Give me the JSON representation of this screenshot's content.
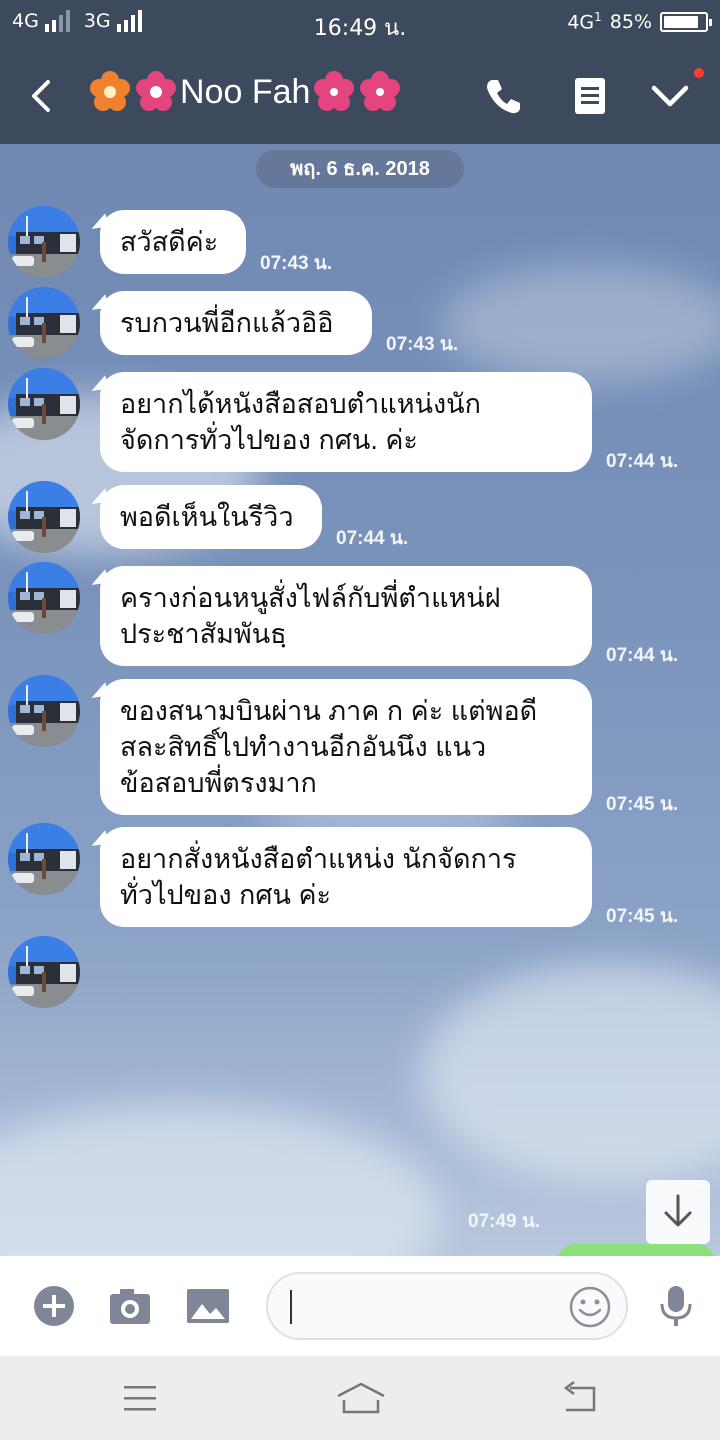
{
  "status": {
    "net1": "4G",
    "net2": "3G",
    "time": "16:49 น.",
    "net3": "4G",
    "net3_sub": "1",
    "battery_pct": "85%",
    "battery_level": 0.85
  },
  "header": {
    "contact_name": "Noo Fah",
    "colors": {
      "bar": "#3d4a5e",
      "flower_orange": "#f0822f",
      "flower_pink": "#e4457e"
    }
  },
  "chat": {
    "date": "พฤ. 6 ธ.ค. 2018",
    "messages": [
      {
        "lines": [
          "สวัสดีค่ะ"
        ],
        "time": "07:43 น."
      },
      {
        "lines": [
          "รบกวนพี่อีกแล้วอิอิ"
        ],
        "time": "07:43 น."
      },
      {
        "lines": [
          "อยากได้หนังสือสอบตำแหน่งนัก",
          "จัดการทั่วไปของ กศน. ค่ะ"
        ],
        "time": "07:44 น."
      },
      {
        "lines": [
          "พอดีเห็นในรีวิว"
        ],
        "time": "07:44 น."
      },
      {
        "lines": [
          "ครางก่อนหนูสั่งไฟล์กับพี่ตำแหน่ฝ",
          "ประชาสัมพันธฺ"
        ],
        "time": "07:44 น."
      },
      {
        "lines": [
          "ของสนามบินผ่าน ภาค ก ค่ะ แต่พอดี",
          "สละสิทธิ์ไปทำงานอีกอันนึง แนว",
          "ข้อสอบพี่ตรงมาก"
        ],
        "time": "07:45 น."
      },
      {
        "lines": [
          "อยากสั่งหนังสือตำแหน่ง นักจัดการ",
          "ทั่วไปของ กศน ค่ะ"
        ],
        "time": "07:45 น."
      }
    ],
    "last_time": "07:49 น."
  },
  "input": {
    "placeholder": ""
  },
  "icons": [
    "back-arrow-icon",
    "phone-icon",
    "notes-icon",
    "chevron-down-icon",
    "scroll-down-arrow-icon",
    "plus-icon",
    "camera-icon",
    "image-icon",
    "emoji-icon",
    "microphone-icon",
    "menu-icon",
    "home-icon",
    "return-icon"
  ]
}
